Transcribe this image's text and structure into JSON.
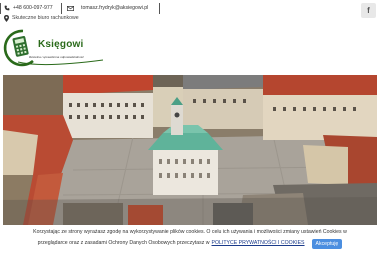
{
  "topbar": {
    "phone": "+48 600-097-977",
    "email": "tomasz.frydryk@aksiegowi.pl",
    "facebook_glyph": "f"
  },
  "tagline": "Skuteczne biuro rachunkowe",
  "logo": {
    "name": "Księgowi",
    "sub": "Rzetelna i sprawdzona odpowiedzialność"
  },
  "cookie": {
    "line1": "Korzystając ze strony wyrażasz zgodę na wykorzystywanie plików cookies. O celu ich używania i możliwości zmiany ustawień Cookies w",
    "line2_prefix": "przeglądarce oraz z zasadami Ochrony Danych Osobowych przeczytasz w",
    "link": "POLITYCE PRYWATNOŚCI I COOKIES",
    "accept": "Akceptuję"
  },
  "colors": {
    "logo_green": "#2a6a1a",
    "accept_blue": "#4b8ee0",
    "roof_red": "#c0452e",
    "copper_green": "#5fb39a"
  },
  "icons": [
    "phone-icon",
    "envelope-icon",
    "map-pin-icon",
    "facebook-icon",
    "calculator-icon"
  ]
}
